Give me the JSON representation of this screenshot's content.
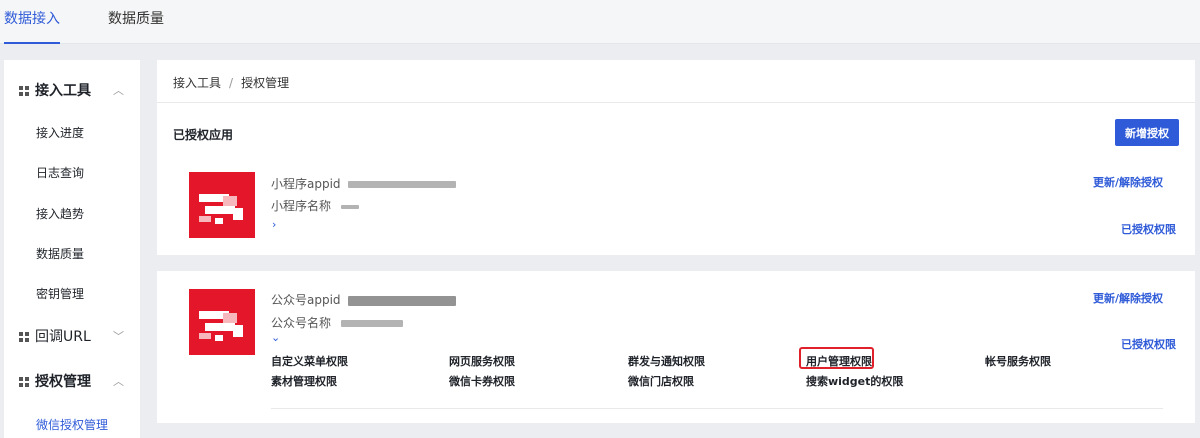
{
  "top_tabs": [
    {
      "label": "数据接入",
      "active": true
    },
    {
      "label": "数据质量",
      "active": false
    }
  ],
  "sidebar": {
    "groups": [
      {
        "label": "接入工具",
        "expanded": true,
        "items": [
          "接入进度",
          "日志查询",
          "接入趋势",
          "数据质量",
          "密钥管理"
        ]
      },
      {
        "label": "回调URL",
        "expanded": false,
        "items": []
      },
      {
        "label": "授权管理",
        "expanded": true,
        "items": [
          "微信授权管理"
        ]
      }
    ]
  },
  "breadcrumb": {
    "root": "接入工具",
    "sep": "/",
    "current": "授权管理"
  },
  "authorized": {
    "title": "已授权应用",
    "new_button": "新增授权",
    "apps": [
      {
        "id_label": "小程序appid",
        "name_label": "小程序名称",
        "toggle": "›",
        "update_link": "更新/解除授权",
        "perm_link": "已授权权限"
      },
      {
        "id_label": "公众号appid",
        "name_label": "公众号名称",
        "toggle": "⌄",
        "update_link": "更新/解除授权",
        "perm_link": "已授权权限",
        "permissions": [
          "自定义菜单权限",
          "网页服务权限",
          "群发与通知权限",
          "用户管理权限",
          "帐号服务权限",
          "素材管理权限",
          "微信卡券权限",
          "微信门店权限",
          "搜索widget的权限"
        ],
        "highlighted_permission": "用户管理权限"
      }
    ]
  },
  "colors": {
    "accent": "#2f5bd8",
    "logo_red": "#e4162a",
    "highlight_border": "#e0202a"
  }
}
